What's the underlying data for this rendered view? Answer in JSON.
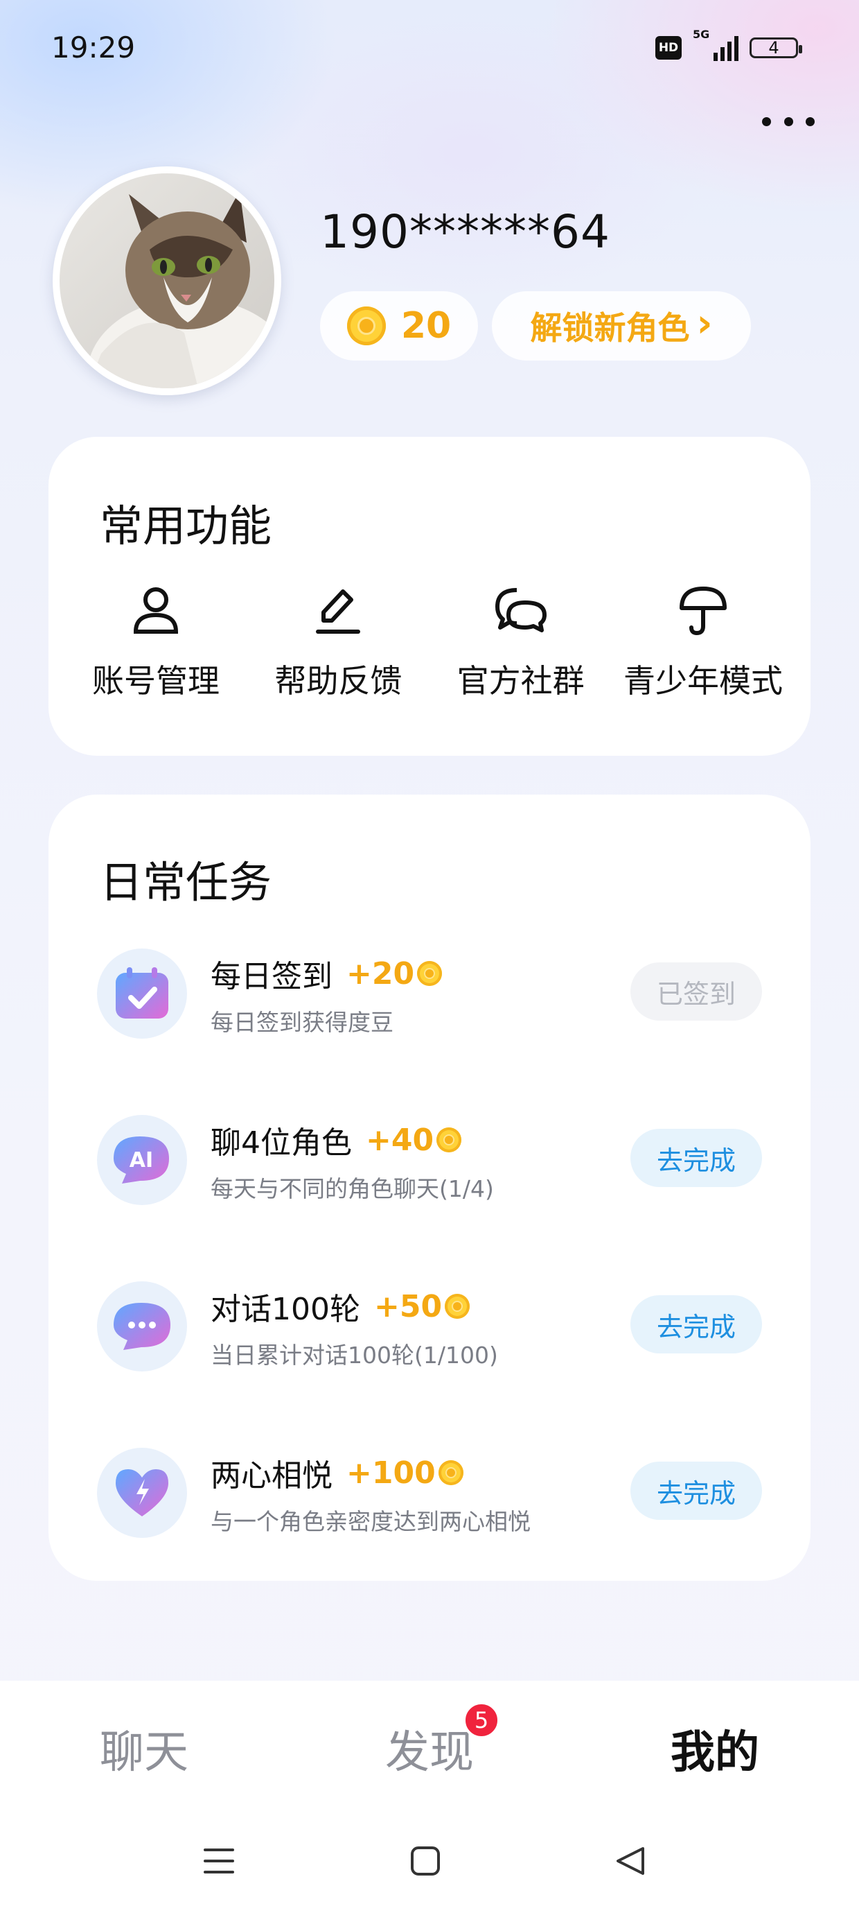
{
  "status_bar": {
    "time": "19:29",
    "hd_label": "HD",
    "network_label": "5G",
    "battery_level": "4"
  },
  "profile": {
    "username": "190******64",
    "coins": "20",
    "unlock_label": "解锁新角色",
    "unlock_chevron": "›"
  },
  "functions": {
    "title": "常用功能",
    "items": [
      {
        "label": "账号管理",
        "icon": "user-icon"
      },
      {
        "label": "帮助反馈",
        "icon": "pen-icon"
      },
      {
        "label": "官方社群",
        "icon": "chat-bubbles-icon"
      },
      {
        "label": "青少年模式",
        "icon": "umbrella-icon"
      }
    ]
  },
  "tasks": {
    "title": "日常任务",
    "items": [
      {
        "title": "每日签到",
        "reward": "+20",
        "desc": "每日签到获得度豆",
        "button": "已签到",
        "state": "done",
        "icon": "calendar-check-icon"
      },
      {
        "title": "聊4位角色",
        "reward": "+40",
        "desc": "每天与不同的角色聊天(1/4)",
        "button": "去完成",
        "state": "todo",
        "icon": "ai-chat-icon"
      },
      {
        "title": "对话100轮",
        "reward": "+50",
        "desc": "当日累计对话100轮(1/100)",
        "button": "去完成",
        "state": "todo",
        "icon": "chat-dots-icon"
      },
      {
        "title": "两心相悦",
        "reward": "+100",
        "desc": "与一个角色亲密度达到两心相悦",
        "button": "去完成",
        "state": "todo",
        "icon": "heart-bolt-icon"
      }
    ]
  },
  "bottom_nav": {
    "tabs": [
      {
        "label": "聊天",
        "active": false
      },
      {
        "label": "发现",
        "active": false,
        "badge": "5"
      },
      {
        "label": "我的",
        "active": true
      }
    ]
  },
  "colors": {
    "accent_gold": "#f4a813",
    "action_blue": "#1e8fe0",
    "badge_red": "#f0233d"
  }
}
